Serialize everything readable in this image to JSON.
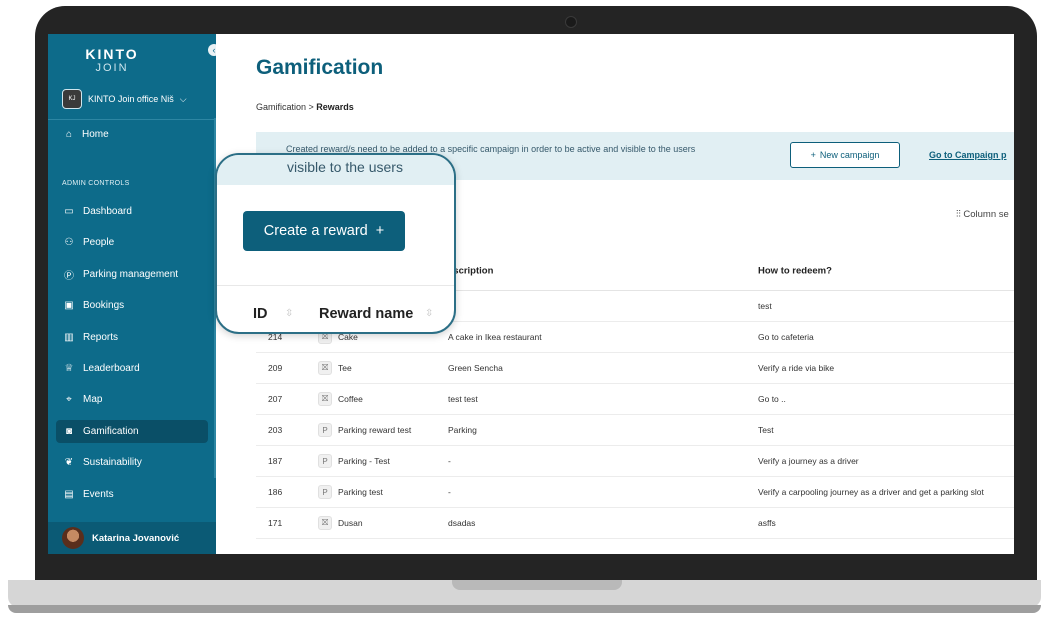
{
  "sidebar": {
    "logo_top": "KINTO",
    "logo_bottom": "JOIN",
    "collapse_icon": "chevron-left-icon",
    "office": "KINTO Join office Niš",
    "office_chevron": "⌵",
    "home": "Home",
    "admin_label": "ADMIN CONTROLS",
    "items": [
      {
        "label": "Dashboard",
        "icon": "calendar-icon",
        "glyph": "▭"
      },
      {
        "label": "People",
        "icon": "people-icon",
        "glyph": "⚇"
      },
      {
        "label": "Parking management",
        "icon": "parking-icon",
        "glyph": "Ⓟ"
      },
      {
        "label": "Bookings",
        "icon": "bookings-icon",
        "glyph": "▣"
      },
      {
        "label": "Reports",
        "icon": "reports-icon",
        "glyph": "▥"
      },
      {
        "label": "Leaderboard",
        "icon": "trophy-icon",
        "glyph": "♕"
      },
      {
        "label": "Map",
        "icon": "map-icon",
        "glyph": "⌖"
      },
      {
        "label": "Gamification",
        "icon": "gamepad-icon",
        "glyph": "◙"
      },
      {
        "label": "Sustainability",
        "icon": "leaf-icon",
        "glyph": "❦"
      },
      {
        "label": "Events",
        "icon": "events-icon",
        "glyph": "▤"
      }
    ],
    "active_item": "Gamification",
    "user_name": "Katarina Jovanović"
  },
  "main": {
    "title": "Gamification",
    "breadcrumb_parent": "Gamification > ",
    "breadcrumb_current": "Rewards",
    "banner_text": "Created reward/s need to be added to a specific campaign in order to be active and visible to the users",
    "new_campaign": "New campaign",
    "go_campaign": "Go to Campaign p",
    "column_settings": "Column se"
  },
  "callout": {
    "banner_text": "visible to the users",
    "create_label": "Create a reward",
    "plus": "+",
    "col_id": "ID",
    "col_name": "Reward name"
  },
  "table": {
    "headers": [
      "",
      "",
      "escription",
      "How to redeem?"
    ],
    "rows": [
      {
        "id": "",
        "icon": "",
        "name": "",
        "desc": "",
        "redeem": "test"
      },
      {
        "id": "214",
        "icon": "gift-icon",
        "glyph": "⛝",
        "name": "Cake",
        "desc": "A cake in Ikea restaurant",
        "redeem": "Go to cafeteria"
      },
      {
        "id": "209",
        "icon": "gift-icon",
        "glyph": "⛝",
        "name": "Tee",
        "desc": "Green Sencha",
        "redeem": "Verify a ride via bike"
      },
      {
        "id": "207",
        "icon": "gift-icon",
        "glyph": "⛝",
        "name": "Coffee",
        "desc": "test test",
        "redeem": "Go to .."
      },
      {
        "id": "203",
        "icon": "parking-icon",
        "glyph": "P",
        "name": "Parking reward test",
        "desc": "Parking",
        "redeem": "Test"
      },
      {
        "id": "187",
        "icon": "parking-icon",
        "glyph": "P",
        "name": "Parking - Test",
        "desc": "-",
        "redeem": "Verify a journey as a driver"
      },
      {
        "id": "186",
        "icon": "parking-icon",
        "glyph": "P",
        "name": "Parking test",
        "desc": "-",
        "redeem": "Verify a carpooling journey as a driver and get a parking slot"
      },
      {
        "id": "171",
        "icon": "gift-icon",
        "glyph": "⛝",
        "name": "Dusan",
        "desc": "dsadas",
        "redeem": "asffs"
      }
    ]
  },
  "colors": {
    "sidebar": "#0d6b8a",
    "accent": "#0d5f7b",
    "banner": "#e1eff3"
  }
}
